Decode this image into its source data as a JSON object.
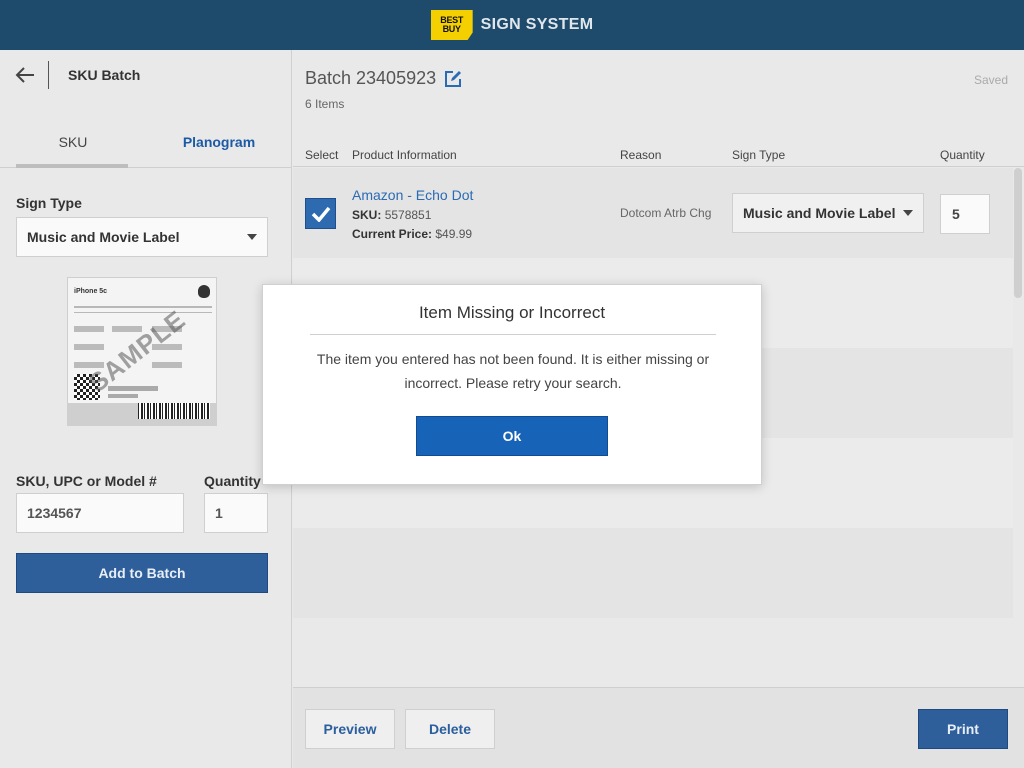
{
  "header": {
    "logo_line1": "BEST",
    "logo_line2": "BUY",
    "app_title": "SIGN SYSTEM"
  },
  "sidebar": {
    "title": "SKU Batch",
    "tabs": [
      {
        "label": "SKU",
        "active": true
      },
      {
        "label": "Planogram",
        "active": false
      }
    ],
    "sign_type_label": "Sign Type",
    "sign_type_value": "Music and Movie Label",
    "sample_text": "SAMPLE",
    "sample_product": "iPhone 5c",
    "sku_label": "SKU, UPC or Model #",
    "sku_value": "1234567",
    "quantity_label": "Quantity",
    "quantity_value": "1",
    "add_button": "Add to Batch"
  },
  "main": {
    "batch_title": "Batch 23405923",
    "items_count": "6 Items",
    "saved_status": "Saved",
    "columns": {
      "select": "Select",
      "product": "Product Information",
      "reason": "Reason",
      "sign_type": "Sign Type",
      "quantity": "Quantity"
    },
    "rows": [
      {
        "selected": true,
        "name": "Amazon - Echo Dot",
        "sku_label": "SKU:",
        "sku": "5578851",
        "price_label": "Current Price:",
        "price": "$49.99",
        "reason": "Dotcom Atrb Chg",
        "sign_type": "Music and Movie Label",
        "quantity": "5"
      }
    ],
    "footer": {
      "preview": "Preview",
      "delete": "Delete",
      "print": "Print"
    }
  },
  "modal": {
    "title": "Item Missing or Incorrect",
    "message": "The item you entered has not been found. It is either missing or incorrect. Please retry your search.",
    "ok_label": "Ok"
  },
  "colors": {
    "header_bg": "#1e4b6b",
    "logo_yellow": "#f5d000",
    "primary_blue": "#2e5f9a",
    "link_blue": "#2a6bb5",
    "ok_blue": "#1763b7"
  }
}
